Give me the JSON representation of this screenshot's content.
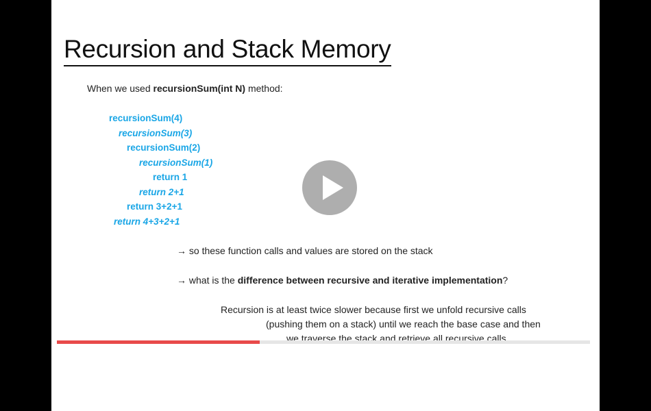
{
  "slide": {
    "title": "Recursion and Stack Memory",
    "intro_prefix": "When we used ",
    "intro_bold": "recursionSum(int N)",
    "intro_suffix": " method:",
    "code_lines": [
      "recursionSum(4)",
      "recursionSum(3)",
      "recursionSum(2)",
      "recursionSum(1)",
      "return 1",
      "return 2+1",
      "return 3+2+1",
      "return 4+3+2+1"
    ],
    "arrow": "→",
    "note1": "so these function calls and values are stored on the stack",
    "note2_prefix": "what is the ",
    "note2_bold": "difference between recursive and iterative implementation",
    "note2_suffix": "?",
    "answer_lines": [
      "Recursion is at least twice slower because first we unfold recursive calls",
      "(pushing them on a stack) until we reach the base case and then",
      "we traverse the stack and retrieve all recursive calls"
    ]
  },
  "player": {
    "play_icon": "play-icon",
    "progress_fraction": 0.38,
    "accent_color": "#e84a4a"
  }
}
